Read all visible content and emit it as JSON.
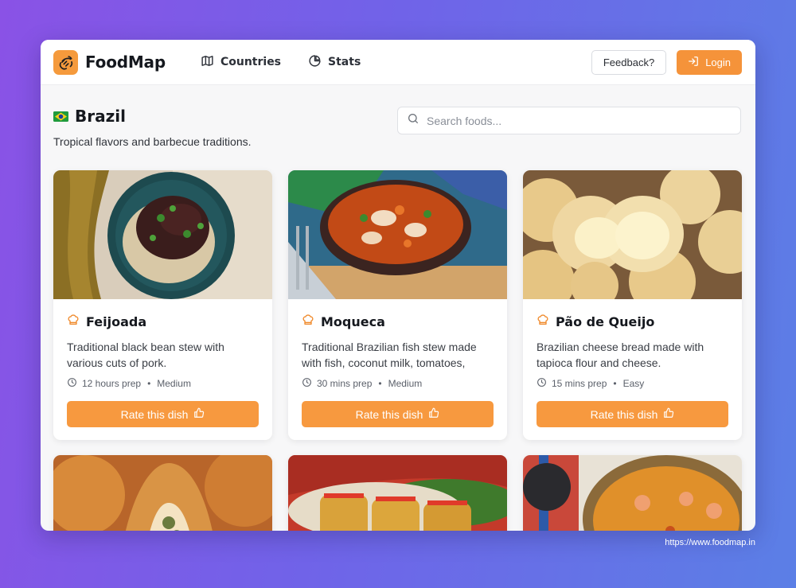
{
  "app": {
    "brand": "FoodMap",
    "nav": [
      {
        "label": "Countries",
        "icon": "map-icon"
      },
      {
        "label": "Stats",
        "icon": "pie-chart-icon"
      }
    ],
    "feedback_label": "Feedback?",
    "login_label": "Login",
    "accent_color": "#f5933a"
  },
  "country": {
    "name": "Brazil",
    "flag_icon": "brazil-flag-icon",
    "tagline": "Tropical flavors and barbecue traditions."
  },
  "search": {
    "placeholder": "Search foods..."
  },
  "dishes": [
    {
      "name": "Feijoada",
      "description": "Traditional black bean stew with various cuts of pork.",
      "prep": "12 hours prep",
      "difficulty": "Medium",
      "rate_label": "Rate this dish"
    },
    {
      "name": "Moqueca",
      "description": "Traditional Brazilian fish stew made with fish, coconut milk, tomatoes, onions,…",
      "prep": "30 mins prep",
      "difficulty": "Medium",
      "rate_label": "Rate this dish"
    },
    {
      "name": "Pão de Queijo",
      "description": "Brazilian cheese bread made with tapioca flour and cheese.",
      "prep": "15 mins prep",
      "difficulty": "Easy",
      "rate_label": "Rate this dish"
    }
  ],
  "footer": {
    "url": "https://www.foodmap.in"
  }
}
